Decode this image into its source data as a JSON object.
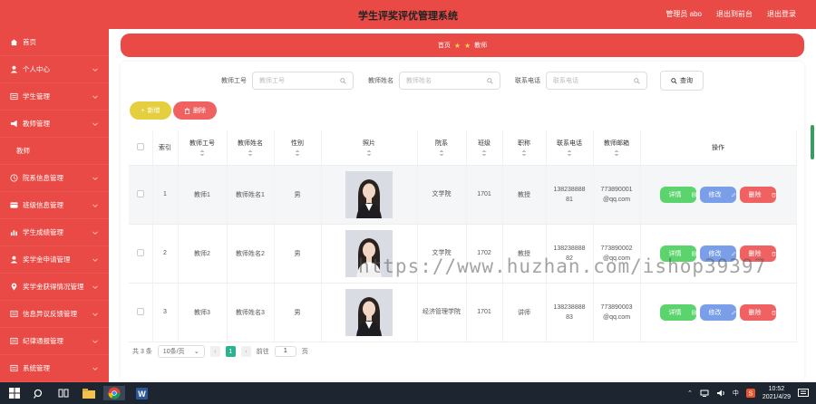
{
  "header": {
    "title": "学生评奖评优管理系统",
    "links": [
      "管理员 abo",
      "退出到前台",
      "退出登录"
    ]
  },
  "sidebar": {
    "items": [
      {
        "label": "首页",
        "icon": "home-icon",
        "chev": false
      },
      {
        "label": "个人中心",
        "icon": "user-icon",
        "chev": true
      },
      {
        "label": "学生管理",
        "icon": "list-icon",
        "chev": true
      },
      {
        "label": "教师管理",
        "icon": "megaphone-icon",
        "chev": true
      },
      {
        "label": "教师",
        "icon": "",
        "chev": false,
        "sub": true
      },
      {
        "label": "院系信息管理",
        "icon": "clock-icon",
        "chev": true
      },
      {
        "label": "班级信息管理",
        "icon": "card-icon",
        "chev": true
      },
      {
        "label": "学生成绩管理",
        "icon": "bar-icon",
        "chev": true
      },
      {
        "label": "奖学金申请管理",
        "icon": "user-icon",
        "chev": true
      },
      {
        "label": "奖学金获得情况管理",
        "icon": "pin-icon",
        "chev": true
      },
      {
        "label": "信息异议反馈管理",
        "icon": "list-icon",
        "chev": true
      },
      {
        "label": "纪律通报管理",
        "icon": "list-icon",
        "chev": true
      },
      {
        "label": "系统管理",
        "icon": "list-icon",
        "chev": true
      }
    ]
  },
  "breadcrumb": {
    "home": "首页",
    "current": "教师"
  },
  "search": {
    "fields": [
      {
        "label": "教师工号",
        "placeholder": "教师工号"
      },
      {
        "label": "教师姓名",
        "placeholder": "教师姓名"
      },
      {
        "label": "联系电话",
        "placeholder": "联系电话"
      }
    ],
    "button": "查询"
  },
  "toolbar": {
    "add": "新增",
    "delete": "删除"
  },
  "table": {
    "columns": [
      "索引",
      "教师工号",
      "教师姓名",
      "性别",
      "照片",
      "院系",
      "班级",
      "职称",
      "联系电话",
      "教师邮箱",
      "操作"
    ],
    "rows": [
      {
        "index": "1",
        "id": "教师1",
        "name": "教师姓名1",
        "gender": "男",
        "dept": "文学院",
        "class": "1701",
        "title": "教授",
        "phone1": "138238888",
        "phone2": "81",
        "mail1": "773890001",
        "mail2": "@qq.com"
      },
      {
        "index": "2",
        "id": "教师2",
        "name": "教师姓名2",
        "gender": "男",
        "dept": "文学院",
        "class": "1702",
        "title": "教授",
        "phone1": "138238888",
        "phone2": "82",
        "mail1": "773890002",
        "mail2": "@qq.com"
      },
      {
        "index": "3",
        "id": "教师3",
        "name": "教师姓名3",
        "gender": "男",
        "dept": "经济管理学院",
        "class": "1701",
        "title": "讲师",
        "phone1": "138238888",
        "phone2": "83",
        "mail1": "773890003",
        "mail2": "@qq.com"
      }
    ],
    "actions": {
      "detail": "详情",
      "edit": "修改",
      "remove": "删除"
    }
  },
  "pager": {
    "total": "共 3 条",
    "size": "10条/页",
    "page": "1",
    "goto": "前往",
    "jump_value": "1",
    "unit": "页"
  },
  "watermark": "https://www.huzhan.com/ishop39397",
  "taskbar": {
    "ime": "中",
    "time": "10:52",
    "date": "2021/4/29"
  },
  "colors": {
    "primary": "#ea4a45",
    "add": "#e6cf3e",
    "detail": "#5cd46d",
    "edit": "#7a9fe8",
    "remove": "#f06262"
  }
}
